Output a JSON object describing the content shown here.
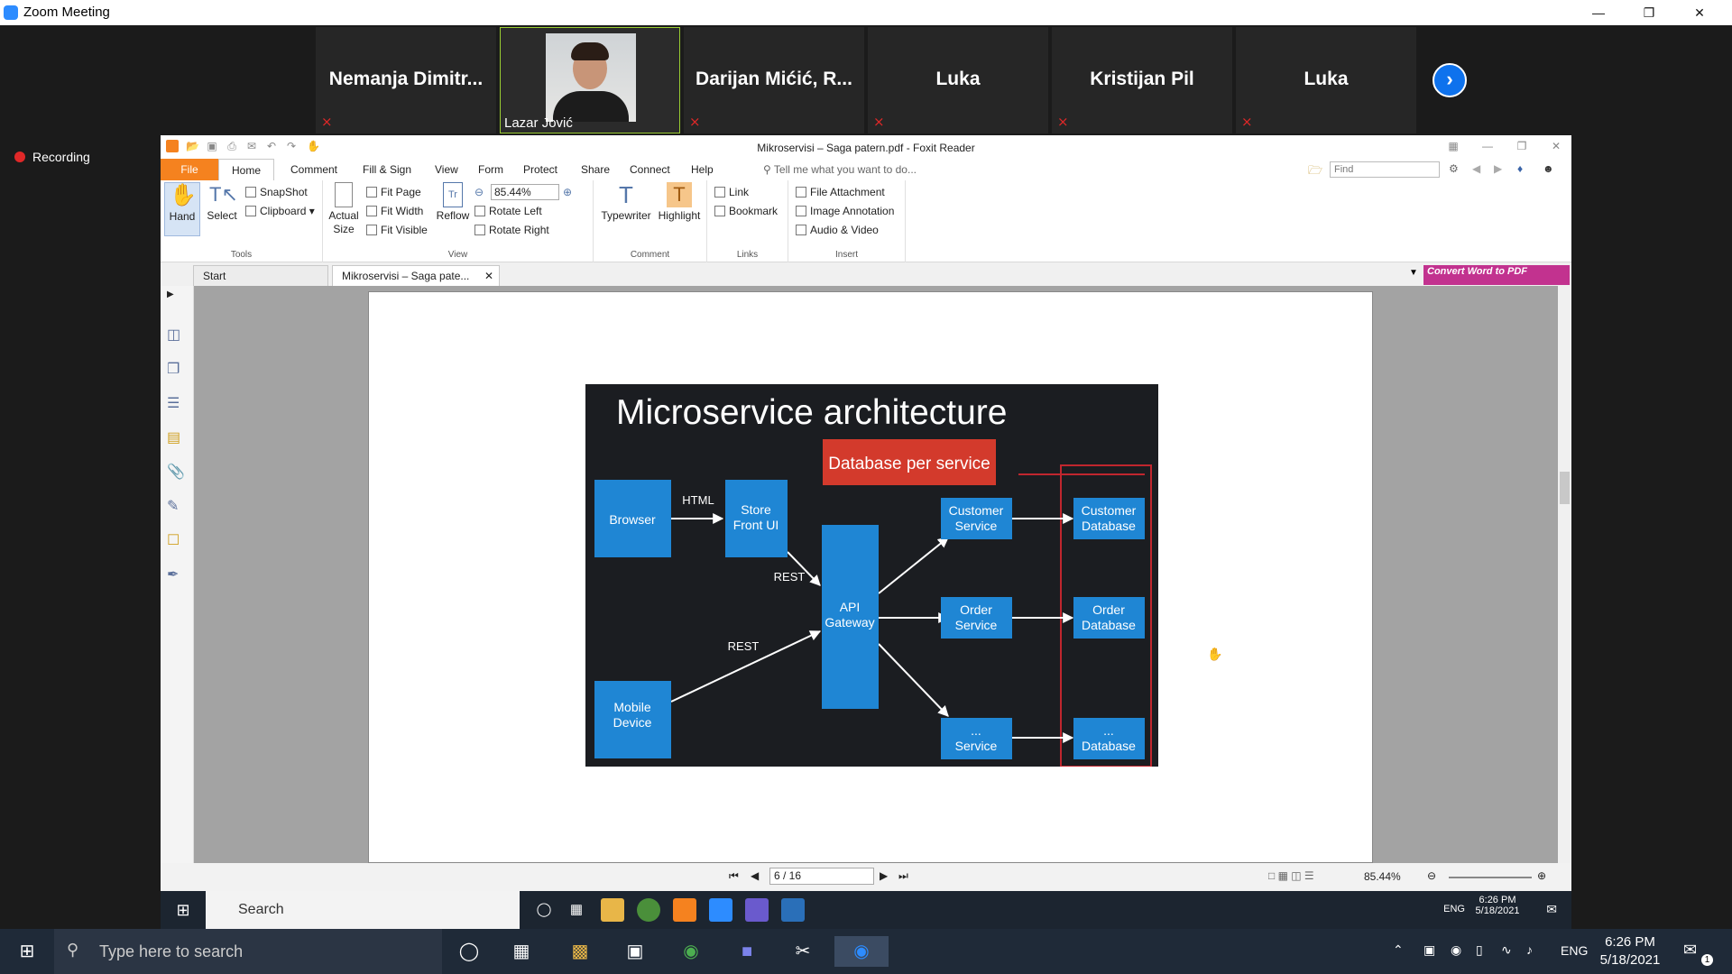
{
  "zoom": {
    "title": "Zoom Meeting",
    "recording_label": "Recording",
    "participants": [
      {
        "name": "Nemanja  Dimitr..."
      },
      {
        "name": "Lazar Jović",
        "video": true
      },
      {
        "name": "Darijan  Mićić, R..."
      },
      {
        "name": "Luka"
      },
      {
        "name": "Kristijan Pil"
      },
      {
        "name": "Luka"
      }
    ]
  },
  "foxit": {
    "window_title": "Mikroservisi – Saga patern.pdf - Foxit Reader",
    "menus": {
      "file": "File",
      "home": "Home",
      "comment": "Comment",
      "fill_sign": "Fill & Sign",
      "view": "View",
      "form": "Form",
      "protect": "Protect",
      "share": "Share",
      "connect": "Connect",
      "help": "Help"
    },
    "tell_me": "Tell me what you want to do...",
    "find_placeholder": "Find",
    "ribbon": {
      "hand": "Hand",
      "select": "Select",
      "snapshot": "SnapShot",
      "clipboard": "Clipboard",
      "tools_label": "Tools",
      "actual_size": "Actual Size",
      "fit_page": "Fit Page",
      "fit_width": "Fit Width",
      "fit_visible": "Fit Visible",
      "reflow": "Reflow",
      "zoom_value": "85.44%",
      "rotate_left": "Rotate Left",
      "rotate_right": "Rotate Right",
      "view_label": "View",
      "typewriter": "Typewriter",
      "highlight": "Highlight",
      "comment_label": "Comment",
      "link": "Link",
      "bookmark": "Bookmark",
      "links_label": "Links",
      "file_attachment": "File Attachment",
      "image_annotation": "Image Annotation",
      "audio_video": "Audio & Video",
      "insert_label": "Insert"
    },
    "tabs": {
      "start": "Start",
      "doc": "Mikroservisi – Saga pate..."
    },
    "convert_banner": "Convert Word to PDF",
    "status": {
      "page": "6 / 16",
      "zoom": "85.44%"
    }
  },
  "slide": {
    "title": "Microservice architecture",
    "db_banner": "Database per service",
    "boxes": {
      "browser": "Browser",
      "store_1": "Store",
      "store_2": "Front UI",
      "gateway_1": "API",
      "gateway_2": "Gateway",
      "mobile_1": "Mobile",
      "mobile_2": "Device",
      "cust_svc_1": "Customer",
      "cust_svc_2": "Service",
      "order_svc_1": "Order",
      "order_svc_2": "Service",
      "etc_svc_1": "...",
      "etc_svc_2": "Service",
      "cust_db_1": "Customer",
      "cust_db_2": "Database",
      "order_db_1": "Order",
      "order_db_2": "Database",
      "etc_db_1": "...",
      "etc_db_2": "Database"
    },
    "edges": {
      "html": "HTML",
      "rest1": "REST",
      "rest2": "REST"
    }
  },
  "shared_taskbar": {
    "search": "Search",
    "tray_lang": "ENG",
    "time": "6:26 PM",
    "date": "5/18/2021"
  },
  "taskbar": {
    "search_placeholder": "Type here to search",
    "lang": "ENG",
    "time": "6:26 PM",
    "date": "5/18/2021",
    "notif_count": "1"
  }
}
